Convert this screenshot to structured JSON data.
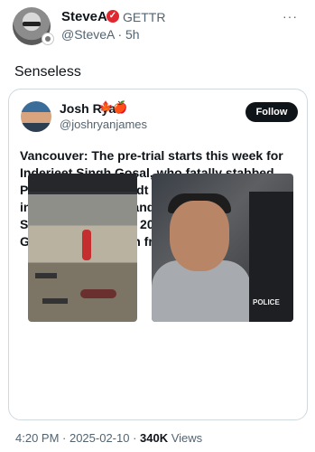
{
  "post": {
    "author_name": "SteveA",
    "platform_label": "GETTR",
    "handle_time": "@SteveA · 5h",
    "text": "Senseless",
    "more_icon": "more-horizontal-icon"
  },
  "quote": {
    "author_name": "Josh Ryan",
    "flag_icons": "🍁🍎",
    "handle": "@joshryanjames",
    "follow_label": "Follow",
    "text": "Vancouver: The pre-trial starts this week for Inderjeet Singh Gosal, who fatally stabbed Paul Stanley Schmidt to death with his kirpan in front of his wife and young daughter at Starbucks in March 2023. Schmidt had asked Gosal not to vape in front of his child.",
    "image_right_tag": "POLICE"
  },
  "meta": {
    "time_date": "4:20 PM · 2025-02-10 · ",
    "views_count": "340K",
    "views_label": " Views"
  },
  "colors": {
    "text": "#0f1419",
    "secondary": "#536471",
    "verified_red": "#e0262f",
    "border": "#cfd9de"
  }
}
